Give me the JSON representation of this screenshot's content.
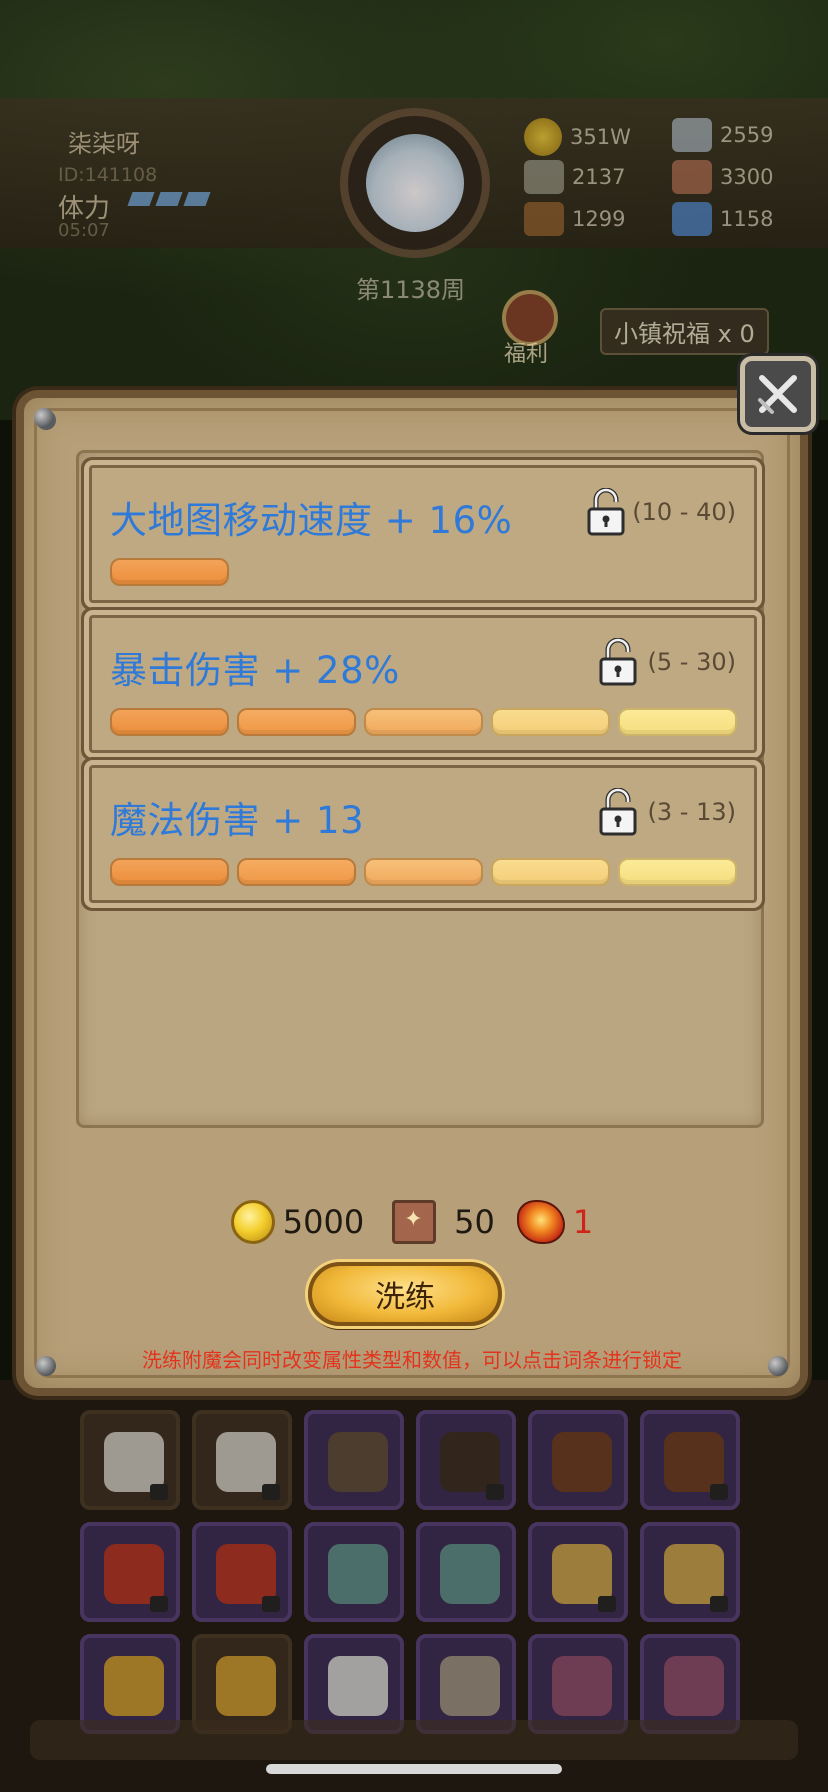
{
  "header": {
    "player_name": "柒柒呀",
    "player_id": "ID:141108",
    "stamina_label": "体力",
    "stamina_timer": "05:07",
    "week": "第1138周"
  },
  "resources": [
    {
      "icon": "gold-coin-icon",
      "value": "351W"
    },
    {
      "icon": "iron-ingot-icon",
      "value": "2559"
    },
    {
      "icon": "stone-ore-icon",
      "value": "2137"
    },
    {
      "icon": "scroll-icon",
      "value": "3300"
    },
    {
      "icon": "wood-log-icon",
      "value": "1299"
    },
    {
      "icon": "blue-crystal-icon",
      "value": "1158"
    }
  ],
  "welfare_label": "福利",
  "blessing_label": "小镇祝福 x 0",
  "attributes": [
    {
      "name": "大地图移动速度 + 16%",
      "range": "(10 - 40)",
      "locked": false,
      "bar_count": 1
    },
    {
      "name": "暴击伤害 + 28%",
      "range": "(5 - 30)",
      "locked": false,
      "bar_count": 5
    },
    {
      "name": "魔法伤害 + 13",
      "range": "(3 - 13)",
      "locked": false,
      "bar_count": 5
    }
  ],
  "cost": {
    "gold": "5000",
    "scroll": "50",
    "ore": "1"
  },
  "wash_button": "洗练",
  "hint": "洗练附魔会同时改变属性类型和数值，可以点击词条进行锁定",
  "colors": {
    "attr_text": "#2f7ad8",
    "hint_text": "#e4331c",
    "panel": "#b7a079"
  }
}
